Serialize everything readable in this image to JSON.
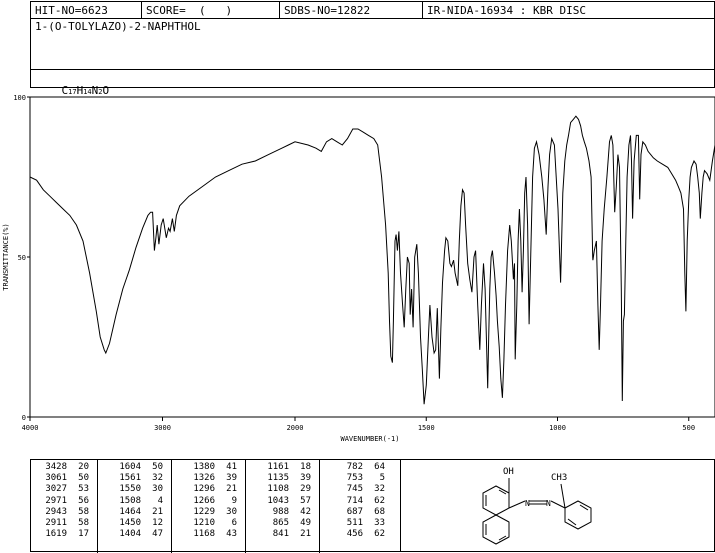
{
  "header": {
    "hit": "HIT-NO=6623",
    "score": "SCORE=  (   )",
    "sdbs": "SDBS-NO=12822",
    "ir": "IR-NIDA-16934 : KBR DISC"
  },
  "compound_name": "1-(O-TOLYLAZO)-2-NAPHTHOL",
  "formula": {
    "c": "C",
    "c_sub": "17",
    "h": "H",
    "h_sub": "14",
    "n": "N",
    "n_sub": "2",
    "o": "O"
  },
  "structure_labels": {
    "oh": "OH",
    "ch3": "CH3"
  },
  "chart_data": {
    "type": "line",
    "xlabel": "WAVENUMBER(-1)",
    "ylabel": "TRANSMITTANCE(%)",
    "xlim": [
      4000,
      400
    ],
    "ylim": [
      0,
      100
    ],
    "x_ticks": [
      "4000",
      "3000",
      "2000",
      "1500",
      "1000",
      "500"
    ],
    "y_ticks": [
      "100",
      "50",
      "0"
    ],
    "series": [
      {
        "points": [
          [
            4000,
            75
          ],
          [
            3950,
            74
          ],
          [
            3900,
            71
          ],
          [
            3850,
            69
          ],
          [
            3800,
            67
          ],
          [
            3750,
            65
          ],
          [
            3700,
            63
          ],
          [
            3650,
            60
          ],
          [
            3600,
            55
          ],
          [
            3550,
            45
          ],
          [
            3500,
            33
          ],
          [
            3470,
            25
          ],
          [
            3440,
            21
          ],
          [
            3428,
            20
          ],
          [
            3400,
            23
          ],
          [
            3350,
            32
          ],
          [
            3300,
            40
          ],
          [
            3250,
            46
          ],
          [
            3200,
            53
          ],
          [
            3150,
            59
          ],
          [
            3110,
            63
          ],
          [
            3090,
            64
          ],
          [
            3075,
            64
          ],
          [
            3061,
            52
          ],
          [
            3050,
            56
          ],
          [
            3040,
            60
          ],
          [
            3027,
            54
          ],
          [
            3010,
            60
          ],
          [
            2995,
            62
          ],
          [
            2971,
            56
          ],
          [
            2955,
            59
          ],
          [
            2943,
            58
          ],
          [
            2925,
            62
          ],
          [
            2911,
            58
          ],
          [
            2895,
            63
          ],
          [
            2870,
            66
          ],
          [
            2800,
            69
          ],
          [
            2700,
            72
          ],
          [
            2600,
            75
          ],
          [
            2500,
            77
          ],
          [
            2400,
            79
          ],
          [
            2300,
            80
          ],
          [
            2200,
            82
          ],
          [
            2100,
            84
          ],
          [
            2050,
            85
          ],
          [
            2000,
            86
          ],
          [
            1950,
            85
          ],
          [
            1920,
            84
          ],
          [
            1900,
            83
          ],
          [
            1880,
            86
          ],
          [
            1860,
            87
          ],
          [
            1840,
            86
          ],
          [
            1820,
            85
          ],
          [
            1800,
            87
          ],
          [
            1780,
            90
          ],
          [
            1760,
            90
          ],
          [
            1740,
            89
          ],
          [
            1720,
            88
          ],
          [
            1700,
            87
          ],
          [
            1685,
            85
          ],
          [
            1670,
            75
          ],
          [
            1655,
            60
          ],
          [
            1645,
            45
          ],
          [
            1640,
            30
          ],
          [
            1635,
            19
          ],
          [
            1629,
            17
          ],
          [
            1625,
            30
          ],
          [
            1619,
            55
          ],
          [
            1615,
            57
          ],
          [
            1610,
            52
          ],
          [
            1604,
            58
          ],
          [
            1598,
            45
          ],
          [
            1590,
            35
          ],
          [
            1584,
            28
          ],
          [
            1578,
            40
          ],
          [
            1572,
            50
          ],
          [
            1565,
            48
          ],
          [
            1561,
            32
          ],
          [
            1556,
            40
          ],
          [
            1550,
            28
          ],
          [
            1544,
            50
          ],
          [
            1536,
            54
          ],
          [
            1530,
            45
          ],
          [
            1522,
            25
          ],
          [
            1515,
            15
          ],
          [
            1508,
            4
          ],
          [
            1500,
            10
          ],
          [
            1492,
            25
          ],
          [
            1486,
            35
          ],
          [
            1478,
            25
          ],
          [
            1470,
            20
          ],
          [
            1464,
            21
          ],
          [
            1458,
            34
          ],
          [
            1450,
            12
          ],
          [
            1444,
            28
          ],
          [
            1438,
            42
          ],
          [
            1430,
            52
          ],
          [
            1425,
            56
          ],
          [
            1418,
            55
          ],
          [
            1410,
            48
          ],
          [
            1404,
            47
          ],
          [
            1396,
            49
          ],
          [
            1390,
            45
          ],
          [
            1380,
            41
          ],
          [
            1374,
            55
          ],
          [
            1368,
            66
          ],
          [
            1362,
            71
          ],
          [
            1356,
            70
          ],
          [
            1350,
            60
          ],
          [
            1342,
            48
          ],
          [
            1334,
            43
          ],
          [
            1326,
            39
          ],
          [
            1318,
            50
          ],
          [
            1312,
            52
          ],
          [
            1304,
            35
          ],
          [
            1296,
            21
          ],
          [
            1290,
            35
          ],
          [
            1282,
            48
          ],
          [
            1276,
            40
          ],
          [
            1266,
            9
          ],
          [
            1262,
            25
          ],
          [
            1258,
            40
          ],
          [
            1253,
            50
          ],
          [
            1248,
            52
          ],
          [
            1240,
            45
          ],
          [
            1234,
            38
          ],
          [
            1229,
            30
          ],
          [
            1222,
            22
          ],
          [
            1216,
            12
          ],
          [
            1210,
            6
          ],
          [
            1204,
            18
          ],
          [
            1198,
            35
          ],
          [
            1190,
            52
          ],
          [
            1182,
            60
          ],
          [
            1176,
            55
          ],
          [
            1168,
            43
          ],
          [
            1164,
            48
          ],
          [
            1161,
            18
          ],
          [
            1155,
            35
          ],
          [
            1150,
            55
          ],
          [
            1145,
            65
          ],
          [
            1140,
            55
          ],
          [
            1135,
            39
          ],
          [
            1130,
            52
          ],
          [
            1125,
            70
          ],
          [
            1120,
            75
          ],
          [
            1114,
            60
          ],
          [
            1108,
            29
          ],
          [
            1102,
            50
          ],
          [
            1095,
            75
          ],
          [
            1088,
            84
          ],
          [
            1080,
            86
          ],
          [
            1070,
            82
          ],
          [
            1060,
            75
          ],
          [
            1052,
            68
          ],
          [
            1043,
            57
          ],
          [
            1036,
            72
          ],
          [
            1030,
            82
          ],
          [
            1022,
            87
          ],
          [
            1012,
            85
          ],
          [
            1005,
            75
          ],
          [
            998,
            65
          ],
          [
            988,
            42
          ],
          [
            980,
            70
          ],
          [
            972,
            80
          ],
          [
            965,
            85
          ],
          [
            958,
            88
          ],
          [
            950,
            92
          ],
          [
            940,
            93
          ],
          [
            930,
            94
          ],
          [
            920,
            93
          ],
          [
            912,
            91
          ],
          [
            905,
            88
          ],
          [
            898,
            86
          ],
          [
            890,
            84
          ],
          [
            880,
            80
          ],
          [
            872,
            75
          ],
          [
            866,
            50
          ],
          [
            865,
            49
          ],
          [
            860,
            52
          ],
          [
            852,
            55
          ],
          [
            846,
            35
          ],
          [
            841,
            21
          ],
          [
            836,
            35
          ],
          [
            830,
            55
          ],
          [
            822,
            65
          ],
          [
            812,
            75
          ],
          [
            802,
            86
          ],
          [
            795,
            88
          ],
          [
            789,
            85
          ],
          [
            782,
            64
          ],
          [
            776,
            72
          ],
          [
            770,
            82
          ],
          [
            764,
            78
          ],
          [
            757,
            40
          ],
          [
            753,
            5
          ],
          [
            749,
            30
          ],
          [
            745,
            32
          ],
          [
            740,
            55
          ],
          [
            735,
            75
          ],
          [
            728,
            85
          ],
          [
            722,
            88
          ],
          [
            718,
            80
          ],
          [
            714,
            62
          ],
          [
            708,
            80
          ],
          [
            700,
            88
          ],
          [
            692,
            88
          ],
          [
            687,
            68
          ],
          [
            682,
            82
          ],
          [
            675,
            86
          ],
          [
            665,
            85
          ],
          [
            655,
            83
          ],
          [
            645,
            82
          ],
          [
            635,
            81
          ],
          [
            620,
            80
          ],
          [
            600,
            79
          ],
          [
            580,
            78
          ],
          [
            565,
            76
          ],
          [
            550,
            74
          ],
          [
            540,
            72
          ],
          [
            530,
            70
          ],
          [
            520,
            65
          ],
          [
            515,
            45
          ],
          [
            511,
            33
          ],
          [
            506,
            55
          ],
          [
            500,
            68
          ],
          [
            495,
            75
          ],
          [
            490,
            78
          ],
          [
            480,
            80
          ],
          [
            472,
            79
          ],
          [
            466,
            75
          ],
          [
            460,
            70
          ],
          [
            456,
            62
          ],
          [
            450,
            70
          ],
          [
            445,
            75
          ],
          [
            440,
            77
          ],
          [
            430,
            76
          ],
          [
            420,
            74
          ],
          [
            410,
            80
          ],
          [
            400,
            85
          ]
        ]
      }
    ],
    "peaks": [
      [
        3428,
        20
      ],
      [
        3061,
        50
      ],
      [
        3027,
        53
      ],
      [
        2971,
        56
      ],
      [
        2943,
        58
      ],
      [
        2911,
        58
      ],
      [
        1619,
        17
      ],
      [
        1604,
        50
      ],
      [
        1561,
        32
      ],
      [
        1550,
        30
      ],
      [
        1508,
        4
      ],
      [
        1464,
        21
      ],
      [
        1450,
        12
      ],
      [
        1404,
        47
      ],
      [
        1380,
        41
      ],
      [
        1326,
        39
      ],
      [
        1296,
        21
      ],
      [
        1266,
        9
      ],
      [
        1229,
        30
      ],
      [
        1210,
        6
      ],
      [
        1168,
        43
      ],
      [
        1161,
        18
      ],
      [
        1135,
        39
      ],
      [
        1108,
        29
      ],
      [
        1043,
        57
      ],
      [
        988,
        42
      ],
      [
        865,
        49
      ],
      [
        841,
        21
      ],
      [
        782,
        64
      ],
      [
        753,
        5
      ],
      [
        745,
        32
      ],
      [
        714,
        62
      ],
      [
        687,
        68
      ],
      [
        511,
        33
      ],
      [
        456,
        62
      ]
    ]
  }
}
